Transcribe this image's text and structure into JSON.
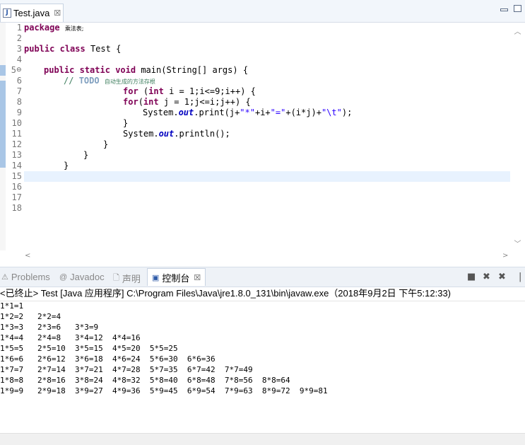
{
  "editor_tab": {
    "label": "Test.java",
    "icon": "J",
    "close": "☒"
  },
  "line_numbers": [
    "1",
    "2",
    "3",
    "4",
    "5",
    "6",
    "7",
    "8",
    "9",
    "10",
    "11",
    "12",
    "13",
    "14",
    "15",
    "16",
    "17",
    "18"
  ],
  "code": {
    "l1": {
      "kw": "package",
      "pkg": "乘法表;"
    },
    "l3": {
      "kw1": "public",
      "kw2": "class",
      "name": "Test {"
    },
    "l5": {
      "kw1": "public",
      "kw2": "static",
      "kw3": "void",
      "rest": "main(String[] args) {"
    },
    "l6": {
      "comment": "//",
      "todo": "TODO",
      "note": "自动生成的方法存根"
    },
    "l7": {
      "kw1": "for",
      "kw2": "int",
      "rest": "i = 1;i<=9;i++) {"
    },
    "l8": {
      "kw1": "for",
      "kw2": "int",
      "rest": "j = 1;j<=i;j++) {"
    },
    "l9": {
      "a": "System.",
      "field": "out",
      "b": ".print(j+",
      "s1": "\"*\"",
      "c": "+i+",
      "s2": "\"=\"",
      "d": "+(i*j)+",
      "s3": "\"\\t\"",
      "e": ");"
    },
    "l10": "}",
    "l11": {
      "a": "System.",
      "field": "out",
      "b": ".println();"
    },
    "l12": "}",
    "l13": "}",
    "l14": "}"
  },
  "view_tabs": [
    {
      "label": "Problems",
      "icon": "⚠"
    },
    {
      "label": "Javadoc",
      "icon": "@"
    },
    {
      "label": "声明",
      "icon": "🗋"
    },
    {
      "label": "控制台",
      "icon": "▣",
      "close": "☒"
    }
  ],
  "console": {
    "header": "<已终止> Test [Java 应用程序] C:\\Program Files\\Java\\jre1.8.0_131\\bin\\javaw.exe（2018年9月2日 下午5:12:33)",
    "lines": [
      "1*1=1",
      "1*2=2   2*2=4",
      "1*3=3   2*3=6   3*3=9",
      "1*4=4   2*4=8   3*4=12  4*4=16",
      "1*5=5   2*5=10  3*5=15  4*5=20  5*5=25",
      "1*6=6   2*6=12  3*6=18  4*6=24  5*6=30  6*6=36",
      "1*7=7   2*7=14  3*7=21  4*7=28  5*7=35  6*7=42  7*7=49",
      "1*8=8   2*8=16  3*8=24  4*8=32  5*8=40  6*8=48  7*8=56  8*8=64",
      "1*9=9   2*9=18  3*9=27  4*9=36  5*9=45  6*9=54  7*9=63  8*9=72  9*9=81"
    ]
  }
}
